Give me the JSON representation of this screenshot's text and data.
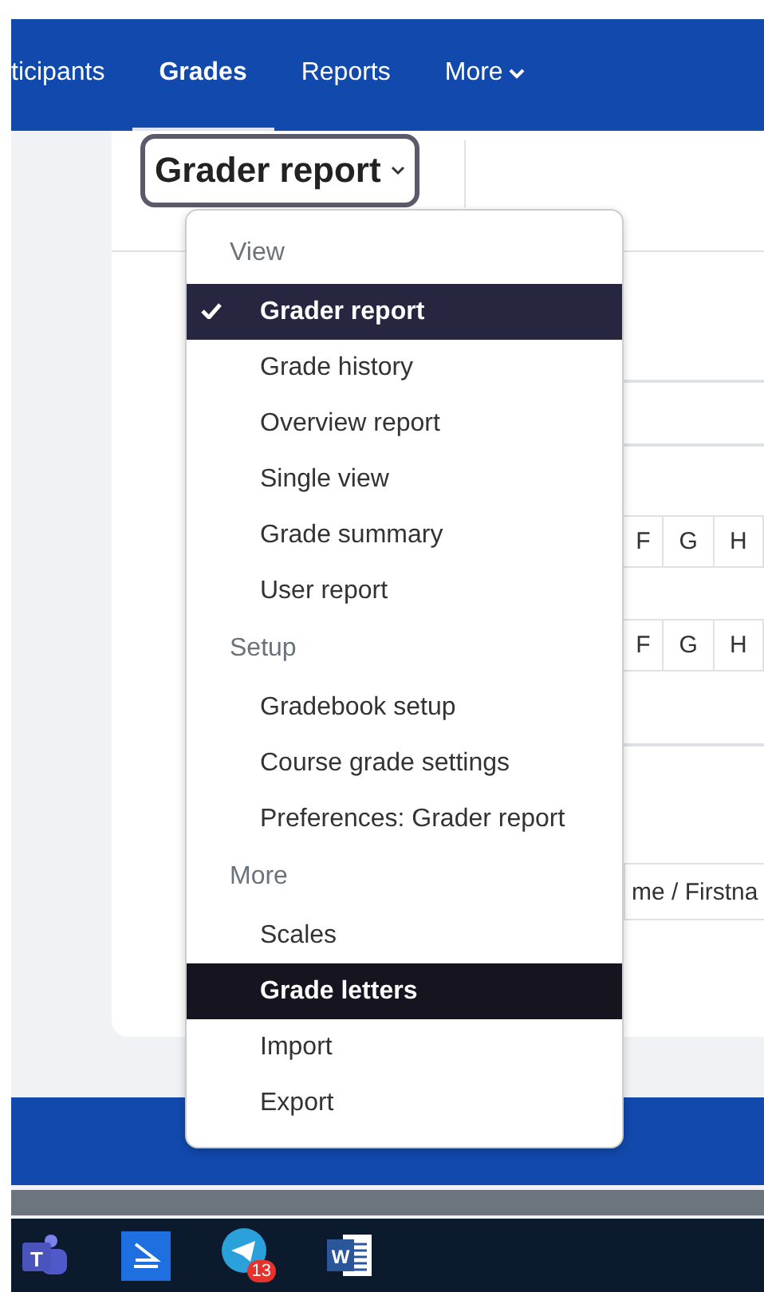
{
  "nav": {
    "tabs": [
      {
        "label": "ticipants",
        "selected": false
      },
      {
        "label": "Grades",
        "selected": true
      },
      {
        "label": "Reports",
        "selected": false
      },
      {
        "label": "More",
        "selected": false,
        "caret": true
      }
    ]
  },
  "report_selector": {
    "label": "Grader report"
  },
  "table": {
    "header_row_1": [
      "F",
      "G",
      "H"
    ],
    "header_row_2": [
      "F",
      "G",
      "H"
    ],
    "name_column": "me / Firstna"
  },
  "menu": {
    "sections": [
      {
        "heading": "View",
        "items": [
          {
            "label": "Grader report",
            "selected": true,
            "hovered": false
          },
          {
            "label": "Grade history",
            "selected": false,
            "hovered": false
          },
          {
            "label": "Overview report",
            "selected": false,
            "hovered": false
          },
          {
            "label": "Single view",
            "selected": false,
            "hovered": false
          },
          {
            "label": "Grade summary",
            "selected": false,
            "hovered": false
          },
          {
            "label": "User report",
            "selected": false,
            "hovered": false
          }
        ]
      },
      {
        "heading": "Setup",
        "items": [
          {
            "label": "Gradebook setup",
            "selected": false,
            "hovered": false
          },
          {
            "label": "Course grade settings",
            "selected": false,
            "hovered": false
          },
          {
            "label": "Preferences: Grader report",
            "selected": false,
            "hovered": false
          }
        ]
      },
      {
        "heading": "More",
        "items": [
          {
            "label": "Scales",
            "selected": false,
            "hovered": false
          },
          {
            "label": "Grade letters",
            "selected": false,
            "hovered": true
          },
          {
            "label": "Import",
            "selected": false,
            "hovered": false
          },
          {
            "label": "Export",
            "selected": false,
            "hovered": false
          }
        ]
      }
    ]
  },
  "taskbar": {
    "apps": [
      {
        "kind": "teams",
        "letter": "T"
      },
      {
        "kind": "reader"
      },
      {
        "kind": "telegram",
        "badge": "13"
      },
      {
        "kind": "word",
        "letter": "W"
      }
    ]
  }
}
